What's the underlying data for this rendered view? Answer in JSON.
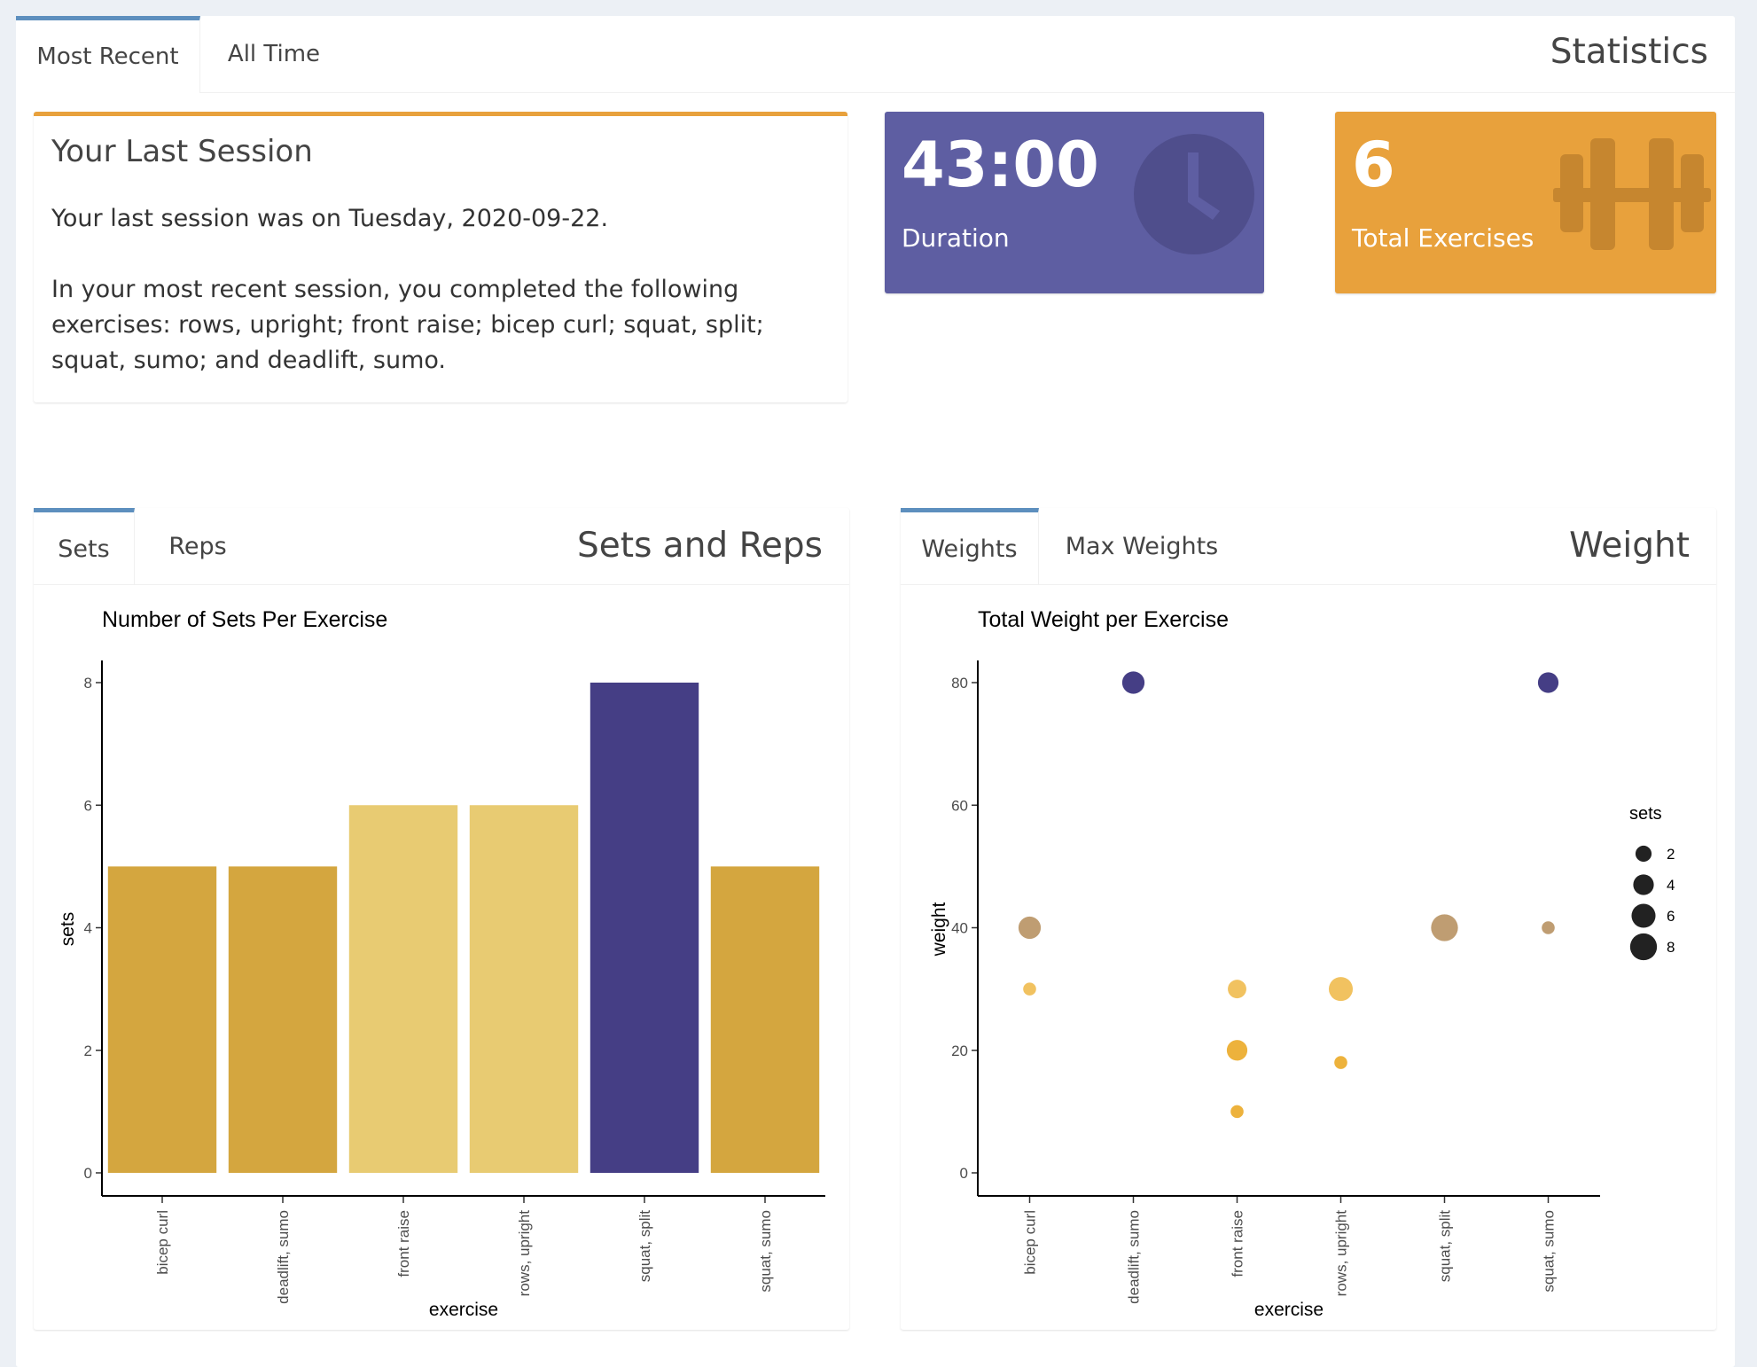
{
  "outer_tabs": [
    "Most Recent",
    "All Time"
  ],
  "outer_title": "Statistics",
  "last_session": {
    "title": "Your Last Session",
    "paragraph1": "Your last session was on Tuesday, 2020-09-22.",
    "paragraph2": "In your most recent session, you completed the following exercises: rows, upright; front raise; bicep curl; squat, split; squat, sumo; and deadlift, sumo."
  },
  "duration_box": {
    "value": "43:00",
    "label": "Duration",
    "icon": "clock-icon",
    "color": "#5e5ea2"
  },
  "exercises_box": {
    "value": "6",
    "label": "Total Exercises",
    "icon": "dumbbell-icon",
    "color": "#e8a13c"
  },
  "sets_reps": {
    "title": "Sets and Reps",
    "tabs": [
      "Sets",
      "Reps"
    ]
  },
  "weight": {
    "title": "Weight",
    "tabs": [
      "Weights",
      "Max Weights"
    ]
  },
  "chart_data": [
    {
      "type": "bar",
      "title": "Number of Sets Per Exercise",
      "xlabel": "exercise",
      "ylabel": "sets",
      "categories": [
        "bicep curl",
        "deadlift, sumo",
        "front raise",
        "rows, upright",
        "squat, split",
        "squat, sumo"
      ],
      "values": [
        5,
        5,
        6,
        6,
        8,
        5
      ],
      "colors": [
        "#d4a63f",
        "#d4a63f",
        "#e8cb72",
        "#e8cb72",
        "#453e85",
        "#d4a63f"
      ],
      "ylim": [
        0,
        8.4
      ],
      "yticks": [
        0,
        2,
        4,
        6,
        8
      ],
      "grid": false
    },
    {
      "type": "scatter",
      "title": "Total Weight per Exercise",
      "xlabel": "exercise",
      "ylabel": "weight",
      "categories": [
        "bicep curl",
        "deadlift, sumo",
        "front raise",
        "rows, upright",
        "squat, split",
        "squat, sumo"
      ],
      "points": [
        {
          "x": "bicep curl",
          "y": 40,
          "size": 5,
          "color": "#bf9d72"
        },
        {
          "x": "bicep curl",
          "y": 30,
          "size": 1,
          "color": "#f1c260"
        },
        {
          "x": "deadlift, sumo",
          "y": 80,
          "size": 5,
          "color": "#453e85"
        },
        {
          "x": "front raise",
          "y": 30,
          "size": 3,
          "color": "#f1c260"
        },
        {
          "x": "front raise",
          "y": 20,
          "size": 4,
          "color": "#edb23c"
        },
        {
          "x": "front raise",
          "y": 10,
          "size": 1,
          "color": "#edb23c"
        },
        {
          "x": "rows, upright",
          "y": 30,
          "size": 6,
          "color": "#f1c260"
        },
        {
          "x": "rows, upright",
          "y": 18,
          "size": 1,
          "color": "#edb23c"
        },
        {
          "x": "squat, split",
          "y": 40,
          "size": 8,
          "color": "#bf9d72"
        },
        {
          "x": "squat, sumo",
          "y": 80,
          "size": 4,
          "color": "#453e85"
        },
        {
          "x": "squat, sumo",
          "y": 40,
          "size": 1,
          "color": "#bf9d72"
        }
      ],
      "ylim": [
        0,
        84
      ],
      "yticks": [
        0,
        20,
        40,
        60,
        80
      ],
      "legend": {
        "title": "sets",
        "entries": [
          2,
          4,
          6,
          8
        ],
        "position": "right"
      },
      "grid": false
    }
  ]
}
